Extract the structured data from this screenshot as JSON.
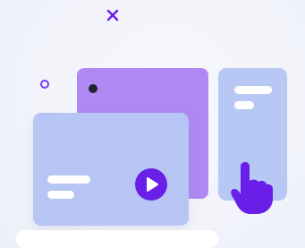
{
  "illustration": {
    "colors": {
      "background": "#f4f5fb",
      "accent_purple": "#6a1fe8",
      "card_purple": "#b088f4",
      "card_blue": "#b8c8f4",
      "front_blue": "#b6c5f3",
      "ring": "#7a3cf0",
      "dot": "#23222f",
      "bar": "#ffffff"
    },
    "icons": {
      "close": "close-icon",
      "ring": "circle-outline-icon",
      "play": "play-icon",
      "hand": "pointer-hand-icon"
    }
  }
}
